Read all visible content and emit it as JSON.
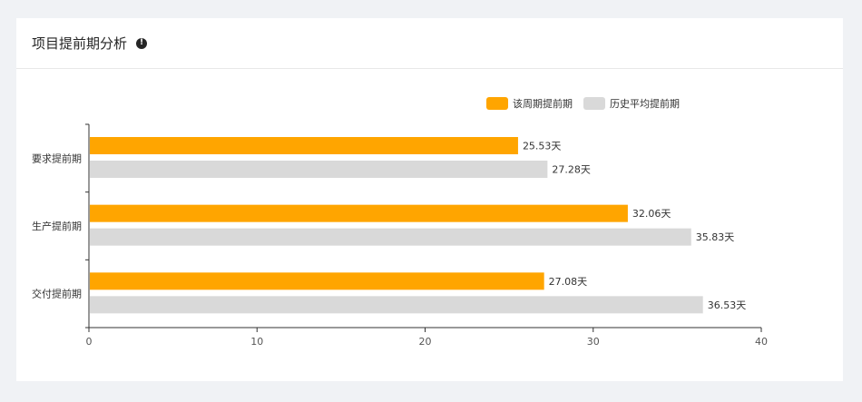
{
  "card": {
    "title": "项目提前期分析",
    "info_icon": "exclamation-circle-icon"
  },
  "colors": {
    "current": "#ffa500",
    "history": "#d9d9d9",
    "axis": "#333333",
    "background": "#f0f2f5"
  },
  "chart_data": {
    "type": "bar",
    "orientation": "horizontal",
    "title": "",
    "xlabel": "",
    "ylabel": "",
    "categories": [
      "要求提前期",
      "生产提前期",
      "交付提前期"
    ],
    "series": [
      {
        "name": "该周期提前期",
        "values": [
          25.53,
          32.06,
          27.08
        ],
        "color": "#ffa500"
      },
      {
        "name": "历史平均提前期",
        "values": [
          27.28,
          35.83,
          36.53
        ],
        "color": "#d9d9d9"
      }
    ],
    "value_suffix": "天",
    "xlim": [
      0,
      40
    ],
    "xticks": [
      0,
      10,
      20,
      30,
      40
    ],
    "grid": false,
    "legend_position": "top-right"
  }
}
